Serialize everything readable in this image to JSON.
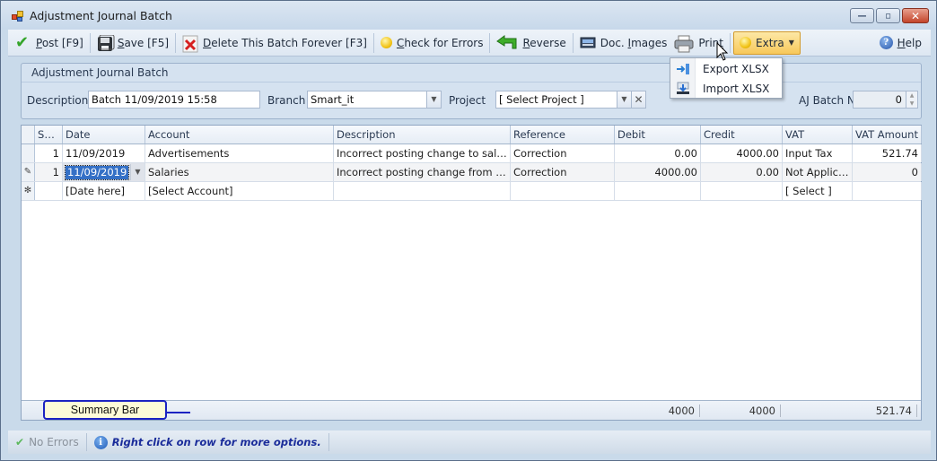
{
  "window": {
    "title": "Adjustment Journal Batch",
    "controls": {
      "minimize": "—",
      "maximize": "▫",
      "close": "✕"
    }
  },
  "toolbar": {
    "post": {
      "label_ul": "P",
      "label_rest": "ost [F9]",
      "icon": "checkmark-icon"
    },
    "save": {
      "label_ul": "S",
      "label_rest": "ave [F5]",
      "icon": "floppy-disk-icon"
    },
    "delete": {
      "label_ul": "D",
      "label_rest": "elete This Batch Forever [F3]",
      "icon": "red-x-icon"
    },
    "check_errors": {
      "label_ul": "C",
      "label_rest": "heck for Errors",
      "icon": "yellow-bulb-icon"
    },
    "reverse": {
      "label_ul": "R",
      "label_rest": "everse",
      "icon": "green-back-arrow-icon"
    },
    "doc_images": {
      "label_pre": "Doc. ",
      "label_ul": "I",
      "label_rest": "mages",
      "icon": "scanner-icon"
    },
    "print": {
      "label_pre": "Prin",
      "label_ul": "t",
      "label_rest": "",
      "icon": "printer-icon"
    },
    "extra": {
      "label": "Extra",
      "icon": "yellow-bulb-icon"
    },
    "help": {
      "label_ul": "H",
      "label_rest": "elp",
      "icon": "help-icon"
    }
  },
  "extra_menu": {
    "items": [
      {
        "label": "Export XLSX",
        "icon": "export-icon"
      },
      {
        "label": "Import XLSX",
        "icon": "import-icon"
      }
    ]
  },
  "header_panel": {
    "title": "Adjustment Journal Batch",
    "description_label": "Description",
    "description_value": "Batch 11/09/2019 15:58",
    "branch_label": "Branch",
    "branch_value": "Smart_it",
    "project_label": "Project",
    "project_value": "[ Select Project ]",
    "batch_no_label": "AJ Batch No",
    "batch_no_value": "0"
  },
  "grid": {
    "columns": [
      "Seq.",
      "Date",
      "Account",
      "Description",
      "Reference",
      "Debit",
      "Credit",
      "VAT",
      "VAT Amount"
    ],
    "rows": [
      {
        "indicator": "",
        "seq": "1",
        "date": "11/09/2019",
        "account": "Advertisements",
        "description": "Incorrect posting change to salaries",
        "reference": "Correction",
        "debit": "0.00",
        "credit": "4000.00",
        "vat": "Input Tax",
        "vat_amount": "521.74"
      },
      {
        "indicator": "✎",
        "seq": "1",
        "date": "11/09/2019",
        "account": "Salaries",
        "description": "Incorrect posting change from adver...",
        "reference": "Correction",
        "debit": "4000.00",
        "credit": "0.00",
        "vat": "Not Applicable",
        "vat_amount": "0"
      },
      {
        "indicator": "✻",
        "seq": "",
        "date": "[Date here]",
        "account": "[Select Account]",
        "description": "",
        "reference": "",
        "debit": "",
        "credit": "",
        "vat": "[ Select ]",
        "vat_amount": ""
      }
    ],
    "summary": {
      "debit_total": "4000",
      "credit_total": "4000",
      "vat_amount_total": "521.74"
    }
  },
  "callout": {
    "label": "Summary Bar"
  },
  "statusbar": {
    "errors": "No Errors",
    "hint": "Right click on row for more options."
  }
}
